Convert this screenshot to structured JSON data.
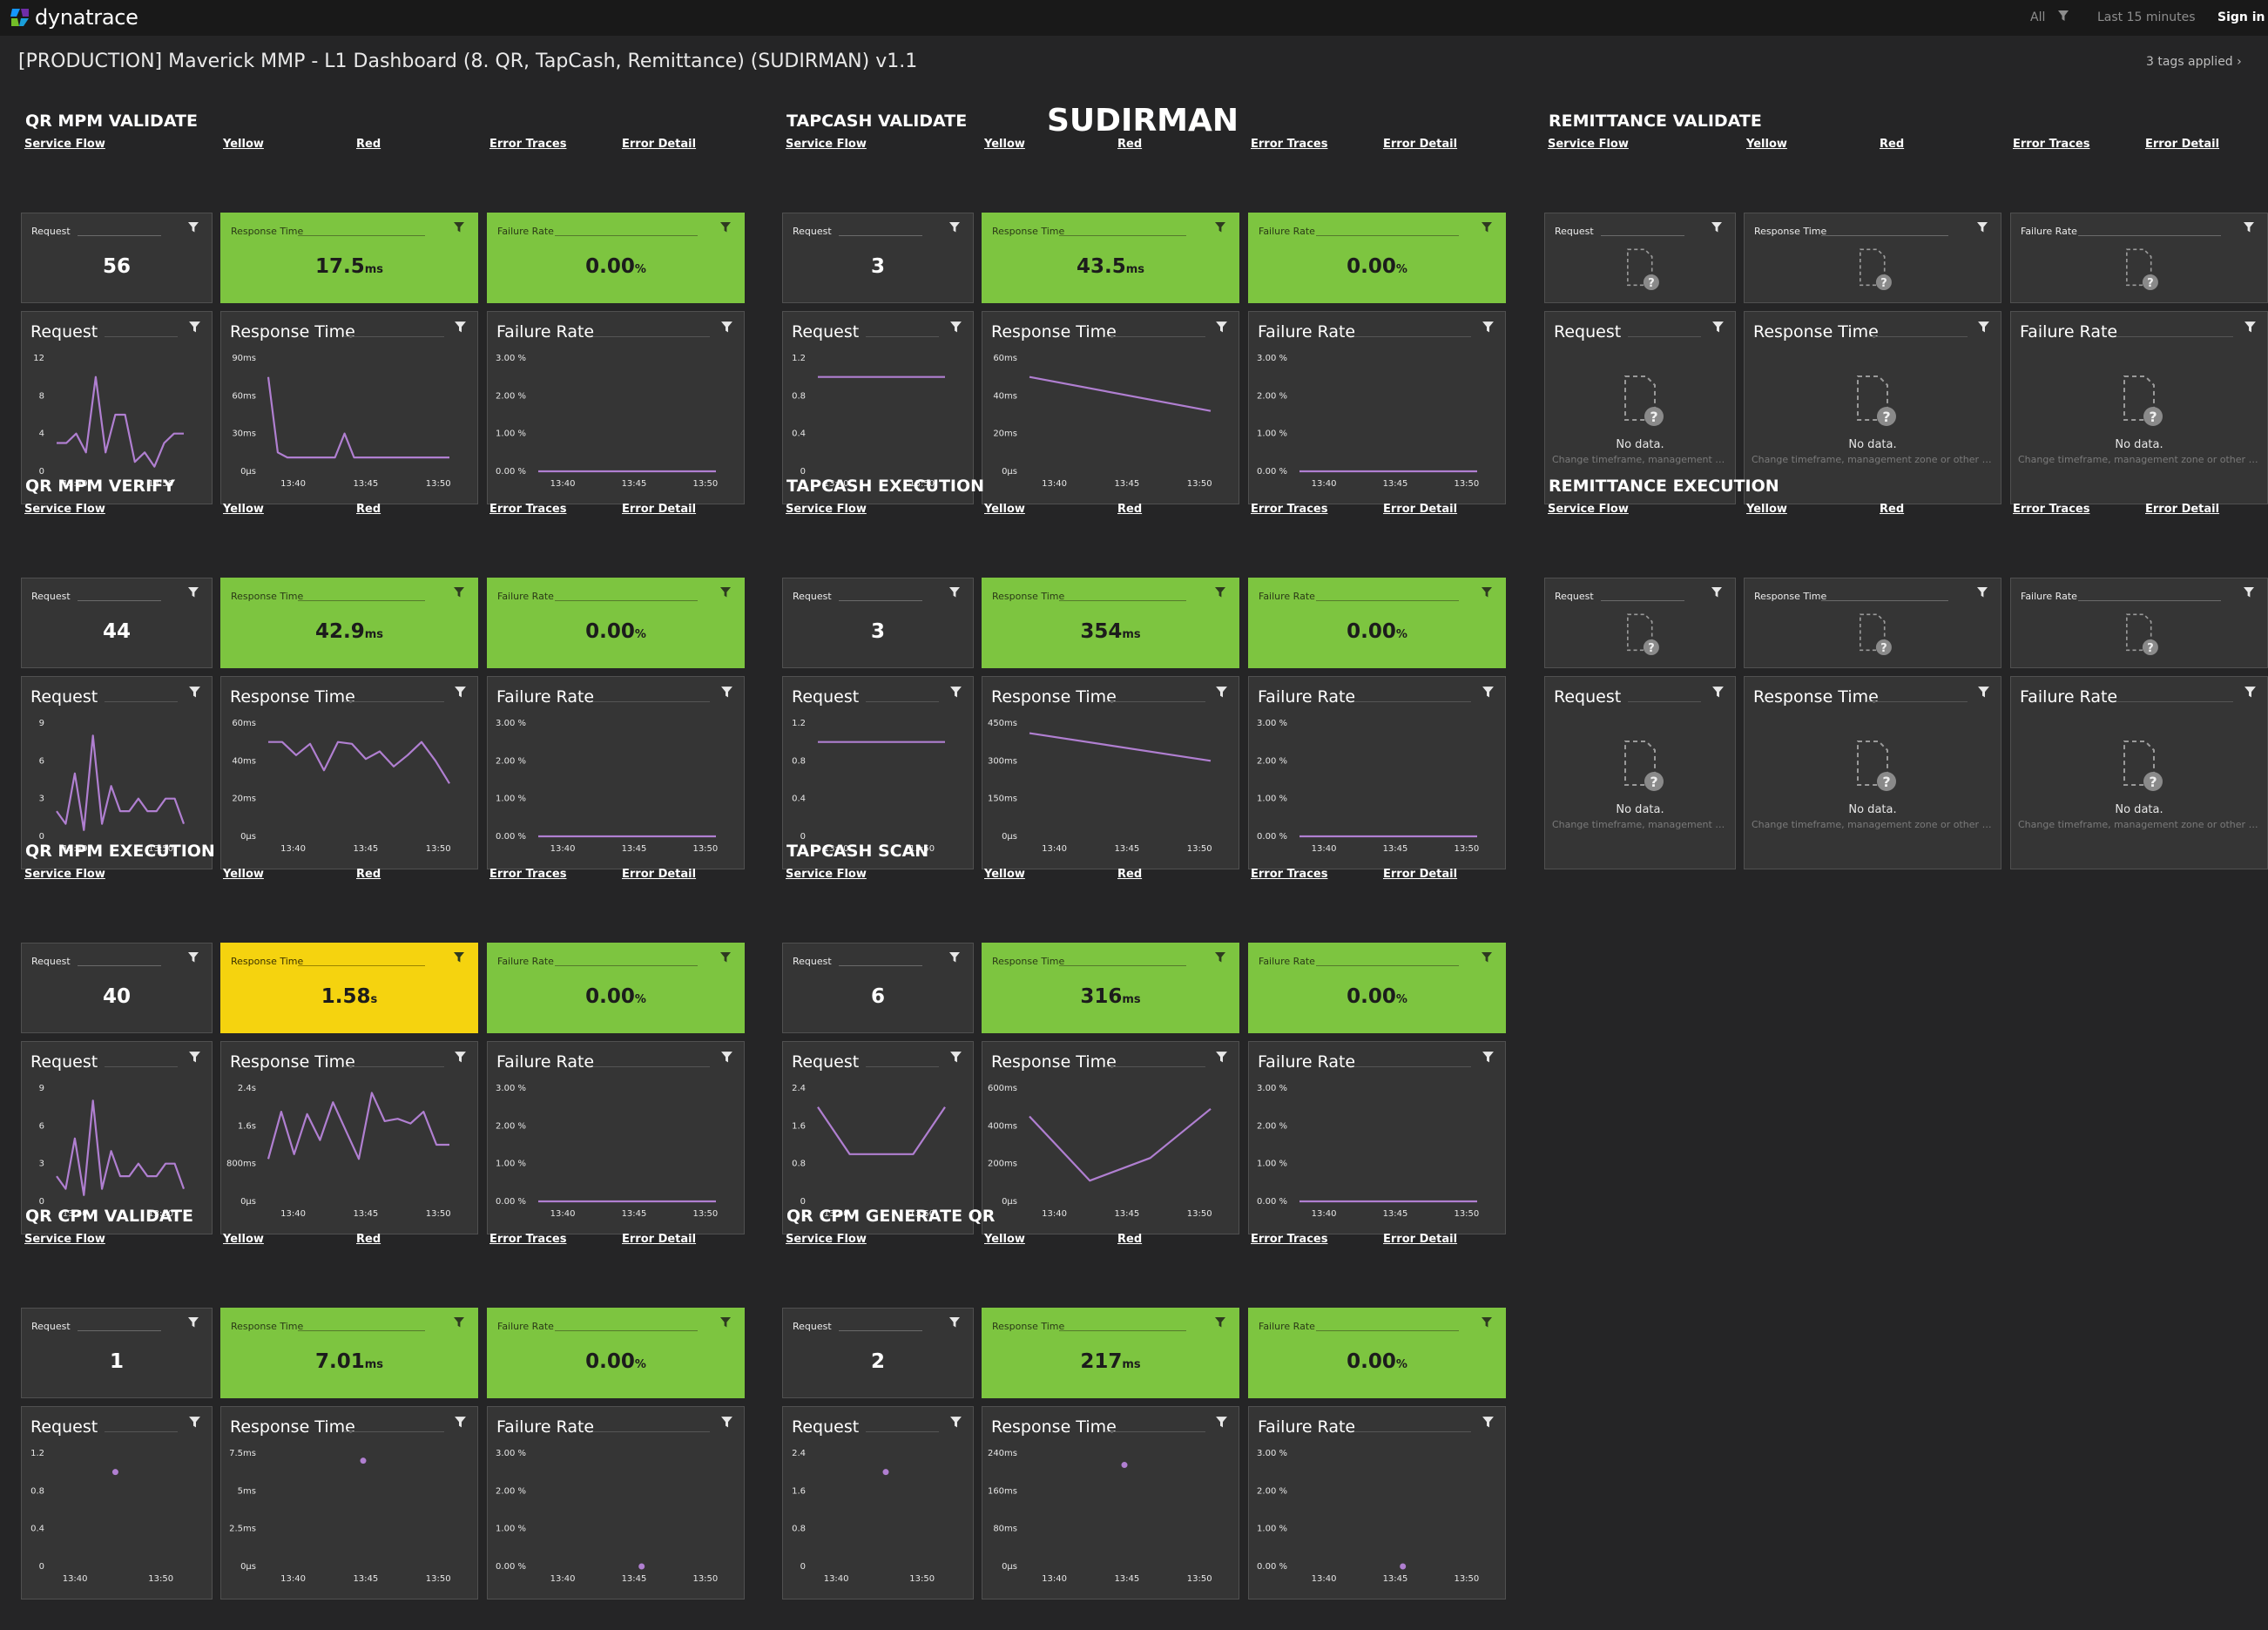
{
  "topbar": {
    "logo_text": "dynatrace",
    "filter_label": "All",
    "timeframe": "Last 15 minutes",
    "sign_in": "Sign in"
  },
  "dashboard": {
    "title": "[PRODUCTION] Maverick MMP - L1 Dashboard (8. QR, TapCash, Remittance) (SUDIRMAN) v1.1",
    "tags": "3 tags applied",
    "heading": "SUDIRMAN"
  },
  "links": [
    "Service Flow",
    "Yellow",
    "Red",
    "Error Traces",
    "Error Detail"
  ],
  "nodata": {
    "title": "No data.",
    "hint_short": "Change timeframe, management z...",
    "hint_long": "Change timeframe, management zone or other fi..."
  },
  "colors": {
    "tile": "#353535",
    "green": "#7dc540",
    "yellow": "#f5d30f",
    "series": "#b07fd1"
  },
  "sections": [
    {
      "title": "QR MPM VALIDATE",
      "col": 0,
      "row": 0,
      "singles": [
        {
          "name": "Request",
          "value": "56",
          "unit": ""
        },
        {
          "name": "Response Time",
          "value": "17.5",
          "unit": "ms",
          "state": "green"
        },
        {
          "name": "Failure Rate",
          "value": "0.00",
          "unit": "%",
          "state": "green"
        }
      ],
      "charts": [
        {
          "title": "Request",
          "yticks": [
            "12",
            "8",
            "4",
            "0"
          ],
          "xticks": [
            "13:40",
            "13:50"
          ],
          "x": [
            0,
            1,
            2,
            3,
            4,
            5,
            6,
            7,
            8,
            9,
            10,
            11,
            12,
            13
          ],
          "y": [
            3,
            3,
            4,
            2,
            10,
            2,
            6,
            6,
            1,
            2,
            0.5,
            3,
            4,
            4
          ]
        },
        {
          "title": "Response Time",
          "yticks": [
            "90ms",
            "60ms",
            "30ms",
            "0μs"
          ],
          "xticks": [
            "13:40",
            "13:45",
            "13:50"
          ],
          "x": [
            0,
            1,
            2,
            3,
            4,
            5,
            6,
            7,
            8,
            9,
            10,
            11,
            12,
            13,
            14,
            15,
            16,
            17,
            18,
            19
          ],
          "y": [
            75,
            15,
            11,
            11,
            11,
            11,
            11,
            11,
            30,
            11,
            11,
            11,
            11,
            11,
            11,
            11,
            11,
            11,
            11,
            11
          ]
        },
        {
          "title": "Failure Rate",
          "yticks": [
            "3.00 %",
            "2.00 %",
            "1.00 %",
            "0.00 %"
          ],
          "xticks": [
            "13:40",
            "13:45",
            "13:50"
          ],
          "x": [
            0,
            1
          ],
          "y": [
            0,
            0
          ]
        }
      ]
    },
    {
      "title": "TAPCASH VALIDATE",
      "col": 1,
      "row": 0,
      "singles": [
        {
          "name": "Request",
          "value": "3",
          "unit": ""
        },
        {
          "name": "Response Time",
          "value": "43.5",
          "unit": "ms",
          "state": "green"
        },
        {
          "name": "Failure Rate",
          "value": "0.00",
          "unit": "%",
          "state": "green"
        }
      ],
      "charts": [
        {
          "title": "Request",
          "yticks": [
            "1.2",
            "0.8",
            "0.4",
            "0"
          ],
          "xticks": [
            "13:40",
            "13:50"
          ],
          "x": [
            0,
            1
          ],
          "y": [
            1,
            1
          ]
        },
        {
          "title": "Response Time",
          "yticks": [
            "60ms",
            "40ms",
            "20ms",
            "0μs"
          ],
          "xticks": [
            "13:40",
            "13:45",
            "13:50"
          ],
          "x": [
            0,
            1
          ],
          "y": [
            50,
            32
          ]
        },
        {
          "title": "Failure Rate",
          "yticks": [
            "3.00 %",
            "2.00 %",
            "1.00 %",
            "0.00 %"
          ],
          "xticks": [
            "13:40",
            "13:45",
            "13:50"
          ],
          "x": [
            0,
            1
          ],
          "y": [
            0,
            0
          ]
        }
      ]
    },
    {
      "title": "REMITTANCE VALIDATE",
      "col": 2,
      "row": 0,
      "nodata": true,
      "singles": [
        {
          "name": "Request"
        },
        {
          "name": "Response Time"
        },
        {
          "name": "Failure Rate"
        }
      ],
      "charts": [
        {
          "title": "Request"
        },
        {
          "title": "Response Time"
        },
        {
          "title": "Failure Rate"
        }
      ]
    },
    {
      "title": "QR MPM VERIFY",
      "col": 0,
      "row": 1,
      "singles": [
        {
          "name": "Request",
          "value": "44",
          "unit": ""
        },
        {
          "name": "Response Time",
          "value": "42.9",
          "unit": "ms",
          "state": "green"
        },
        {
          "name": "Failure Rate",
          "value": "0.00",
          "unit": "%",
          "state": "green"
        }
      ],
      "charts": [
        {
          "title": "Request",
          "yticks": [
            "9",
            "6",
            "3",
            "0"
          ],
          "xticks": [
            "13:40",
            "13:50"
          ],
          "x": [
            0,
            1,
            2,
            3,
            4,
            5,
            6,
            7,
            8,
            9,
            10,
            11,
            12,
            13,
            14
          ],
          "y": [
            2,
            1,
            5,
            0.5,
            8,
            1,
            4,
            2,
            2,
            3,
            2,
            2,
            3,
            3,
            1
          ]
        },
        {
          "title": "Response Time",
          "yticks": [
            "60ms",
            "40ms",
            "20ms",
            "0μs"
          ],
          "xticks": [
            "13:40",
            "13:45",
            "13:50"
          ],
          "x": [
            0,
            1,
            2,
            3,
            4,
            5,
            6,
            7,
            8,
            9,
            10,
            11,
            12,
            13
          ],
          "y": [
            50,
            50,
            43,
            49,
            35,
            50,
            49,
            41,
            45,
            37,
            43,
            50,
            40,
            28
          ]
        },
        {
          "title": "Failure Rate",
          "yticks": [
            "3.00 %",
            "2.00 %",
            "1.00 %",
            "0.00 %"
          ],
          "xticks": [
            "13:40",
            "13:45",
            "13:50"
          ],
          "x": [
            0,
            1
          ],
          "y": [
            0,
            0
          ]
        }
      ]
    },
    {
      "title": "TAPCASH EXECUTION",
      "col": 1,
      "row": 1,
      "singles": [
        {
          "name": "Request",
          "value": "3",
          "unit": ""
        },
        {
          "name": "Response Time",
          "value": "354",
          "unit": "ms",
          "state": "green"
        },
        {
          "name": "Failure Rate",
          "value": "0.00",
          "unit": "%",
          "state": "green"
        }
      ],
      "charts": [
        {
          "title": "Request",
          "yticks": [
            "1.2",
            "0.8",
            "0.4",
            "0"
          ],
          "xticks": [
            "13:40",
            "13:50"
          ],
          "x": [
            0,
            1
          ],
          "y": [
            1,
            1
          ]
        },
        {
          "title": "Response Time",
          "yticks": [
            "450ms",
            "300ms",
            "150ms",
            "0μs"
          ],
          "xticks": [
            "13:40",
            "13:45",
            "13:50"
          ],
          "x": [
            0,
            1
          ],
          "y": [
            410,
            300
          ]
        },
        {
          "title": "Failure Rate",
          "yticks": [
            "3.00 %",
            "2.00 %",
            "1.00 %",
            "0.00 %"
          ],
          "xticks": [
            "13:40",
            "13:45",
            "13:50"
          ],
          "x": [
            0,
            1
          ],
          "y": [
            0,
            0
          ]
        }
      ]
    },
    {
      "title": "REMITTANCE EXECUTION",
      "col": 2,
      "row": 1,
      "nodata": true,
      "singles": [
        {
          "name": "Request"
        },
        {
          "name": "Response Time"
        },
        {
          "name": "Failure Rate"
        }
      ],
      "charts": [
        {
          "title": "Request"
        },
        {
          "title": "Response Time"
        },
        {
          "title": "Failure Rate"
        }
      ]
    },
    {
      "title": "QR MPM EXECUTION",
      "col": 0,
      "row": 2,
      "singles": [
        {
          "name": "Request",
          "value": "40",
          "unit": ""
        },
        {
          "name": "Response Time",
          "value": "1.58",
          "unit": "s",
          "state": "yellow"
        },
        {
          "name": "Failure Rate",
          "value": "0.00",
          "unit": "%",
          "state": "green"
        }
      ],
      "charts": [
        {
          "title": "Request",
          "yticks": [
            "9",
            "6",
            "3",
            "0"
          ],
          "xticks": [
            "13:40",
            "13:50"
          ],
          "x": [
            0,
            1,
            2,
            3,
            4,
            5,
            6,
            7,
            8,
            9,
            10,
            11,
            12,
            13,
            14
          ],
          "y": [
            2,
            1,
            5,
            0.5,
            8,
            1,
            4,
            2,
            2,
            3,
            2,
            2,
            3,
            3,
            1
          ]
        },
        {
          "title": "Response Time",
          "yticks": [
            "2.4s",
            "1.6s",
            "800ms",
            "0μs"
          ],
          "xticks": [
            "13:40",
            "13:45",
            "13:50"
          ],
          "x": [
            0,
            1,
            2,
            3,
            4,
            5,
            6,
            7,
            8,
            9,
            10,
            11,
            12,
            13,
            14
          ],
          "y": [
            0.9,
            1.9,
            1.0,
            1.85,
            1.3,
            2.1,
            1.5,
            0.9,
            2.3,
            1.7,
            1.75,
            1.65,
            1.9,
            1.2,
            1.2
          ]
        },
        {
          "title": "Failure Rate",
          "yticks": [
            "3.00 %",
            "2.00 %",
            "1.00 %",
            "0.00 %"
          ],
          "xticks": [
            "13:40",
            "13:45",
            "13:50"
          ],
          "x": [
            0,
            1
          ],
          "y": [
            0,
            0
          ]
        }
      ]
    },
    {
      "title": "TAPCASH SCAN",
      "col": 1,
      "row": 2,
      "singles": [
        {
          "name": "Request",
          "value": "6",
          "unit": ""
        },
        {
          "name": "Response Time",
          "value": "316",
          "unit": "ms",
          "state": "green"
        },
        {
          "name": "Failure Rate",
          "value": "0.00",
          "unit": "%",
          "state": "green"
        }
      ],
      "charts": [
        {
          "title": "Request",
          "yticks": [
            "2.4",
            "1.6",
            "0.8",
            "0"
          ],
          "xticks": [
            "13:40",
            "13:50"
          ],
          "x": [
            0,
            1,
            2,
            3,
            4
          ],
          "y": [
            2,
            1,
            1,
            1,
            2
          ]
        },
        {
          "title": "Response Time",
          "yticks": [
            "600ms",
            "400ms",
            "200ms",
            "0μs"
          ],
          "xticks": [
            "13:40",
            "13:45",
            "13:50"
          ],
          "x": [
            0,
            1,
            2,
            3
          ],
          "y": [
            450,
            110,
            230,
            490
          ]
        },
        {
          "title": "Failure Rate",
          "yticks": [
            "3.00 %",
            "2.00 %",
            "1.00 %",
            "0.00 %"
          ],
          "xticks": [
            "13:40",
            "13:45",
            "13:50"
          ],
          "x": [
            0,
            1
          ],
          "y": [
            0,
            0
          ]
        }
      ]
    },
    {
      "title": "QR CPM VALIDATE",
      "col": 0,
      "row": 3,
      "singles": [
        {
          "name": "Request",
          "value": "1",
          "unit": ""
        },
        {
          "name": "Response Time",
          "value": "7.01",
          "unit": "ms",
          "state": "green"
        },
        {
          "name": "Failure Rate",
          "value": "0.00",
          "unit": "%",
          "state": "green"
        }
      ],
      "charts": [
        {
          "title": "Request",
          "yticks": [
            "1.2",
            "0.8",
            "0.4",
            "0"
          ],
          "xticks": [
            "13:40",
            "13:50"
          ],
          "x": [
            0.44
          ],
          "y": [
            1
          ]
        },
        {
          "title": "Response Time",
          "yticks": [
            "7.5ms",
            "5ms",
            "2.5ms",
            "0μs"
          ],
          "xticks": [
            "13:40",
            "13:45",
            "13:50"
          ],
          "x": [
            0.5
          ],
          "y": [
            7
          ]
        },
        {
          "title": "Failure Rate",
          "yticks": [
            "3.00 %",
            "2.00 %",
            "1.00 %",
            "0.00 %"
          ],
          "xticks": [
            "13:40",
            "13:45",
            "13:50"
          ],
          "x": [
            0.55
          ],
          "y": [
            0
          ]
        }
      ]
    },
    {
      "title": "QR CPM GENERATE QR",
      "col": 1,
      "row": 3,
      "singles": [
        {
          "name": "Request",
          "value": "2",
          "unit": ""
        },
        {
          "name": "Response Time",
          "value": "217",
          "unit": "ms",
          "state": "green"
        },
        {
          "name": "Failure Rate",
          "value": "0.00",
          "unit": "%",
          "state": "green"
        }
      ],
      "charts": [
        {
          "title": "Request",
          "yticks": [
            "2.4",
            "1.6",
            "0.8",
            "0"
          ],
          "xticks": [
            "13:40",
            "13:50"
          ],
          "x": [
            0.5
          ],
          "y": [
            2
          ]
        },
        {
          "title": "Response Time",
          "yticks": [
            "240ms",
            "160ms",
            "80ms",
            "0μs"
          ],
          "xticks": [
            "13:40",
            "13:45",
            "13:50"
          ],
          "x": [
            0.5
          ],
          "y": [
            215
          ]
        },
        {
          "title": "Failure Rate",
          "yticks": [
            "3.00 %",
            "2.00 %",
            "1.00 %",
            "0.00 %"
          ],
          "xticks": [
            "13:40",
            "13:45",
            "13:50"
          ],
          "x": [
            0.55
          ],
          "y": [
            0
          ]
        }
      ]
    }
  ]
}
